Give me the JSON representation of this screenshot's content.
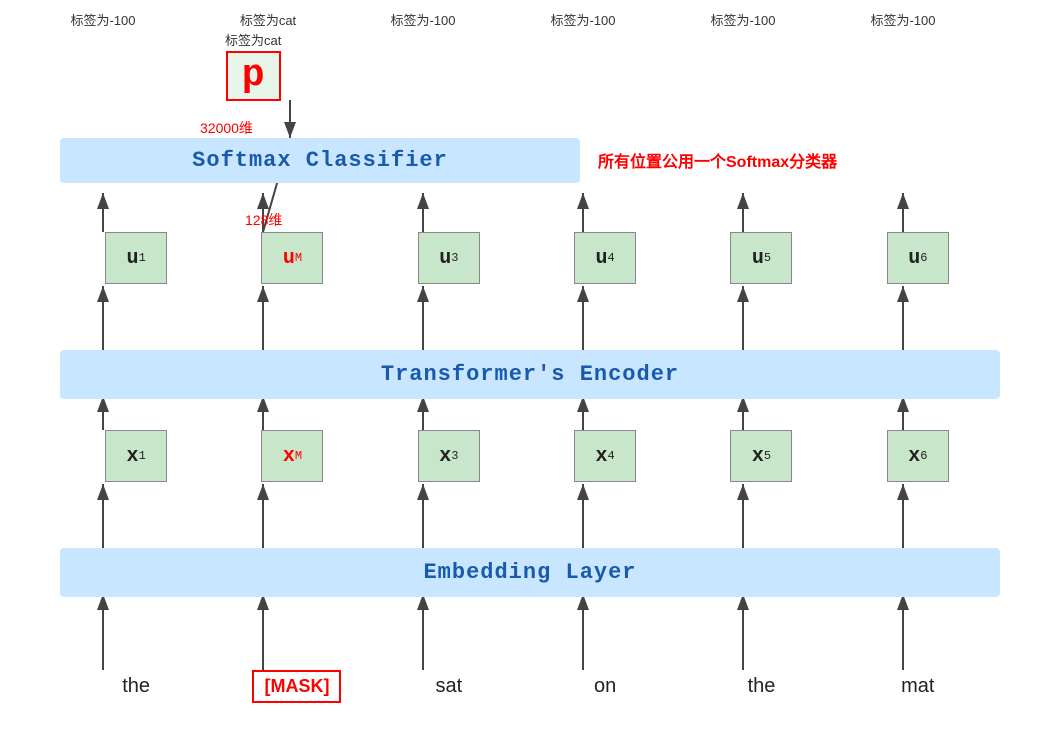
{
  "labels": {
    "label1": "标签为-100",
    "label2": "标签为cat",
    "label3": "标签为-100",
    "label4": "标签为-100",
    "label5": "标签为-100",
    "label6": "标签为-100"
  },
  "p_box": {
    "label": "标签为cat",
    "letter": "p"
  },
  "dim_32000": "32000维",
  "softmax": {
    "text": "Softmax Classifier",
    "annotation": "所有位置公用一个Softmax分类器"
  },
  "dim_128": "128维",
  "u_nodes": [
    "u₁",
    "uₘ",
    "u₃",
    "u₄",
    "u₅",
    "u₆"
  ],
  "u_subs": [
    "1",
    "M",
    "3",
    "4",
    "5",
    "6"
  ],
  "transformer": {
    "text": "Transformer's Encoder"
  },
  "x_nodes": [
    "x₁",
    "xₘ",
    "x₃",
    "x₄",
    "x₅",
    "x₆"
  ],
  "x_subs": [
    "1",
    "M",
    "3",
    "4",
    "5",
    "6"
  ],
  "embedding": {
    "text": "Embedding Layer"
  },
  "words": [
    "the",
    "[MASK]",
    "sat",
    "on",
    "the",
    "mat"
  ],
  "colors": {
    "blue_bar": "#c8e6ff",
    "green_node": "#c8e6c9",
    "red_border": "red",
    "blue_text": "#1a5aad",
    "red_text": "red"
  }
}
